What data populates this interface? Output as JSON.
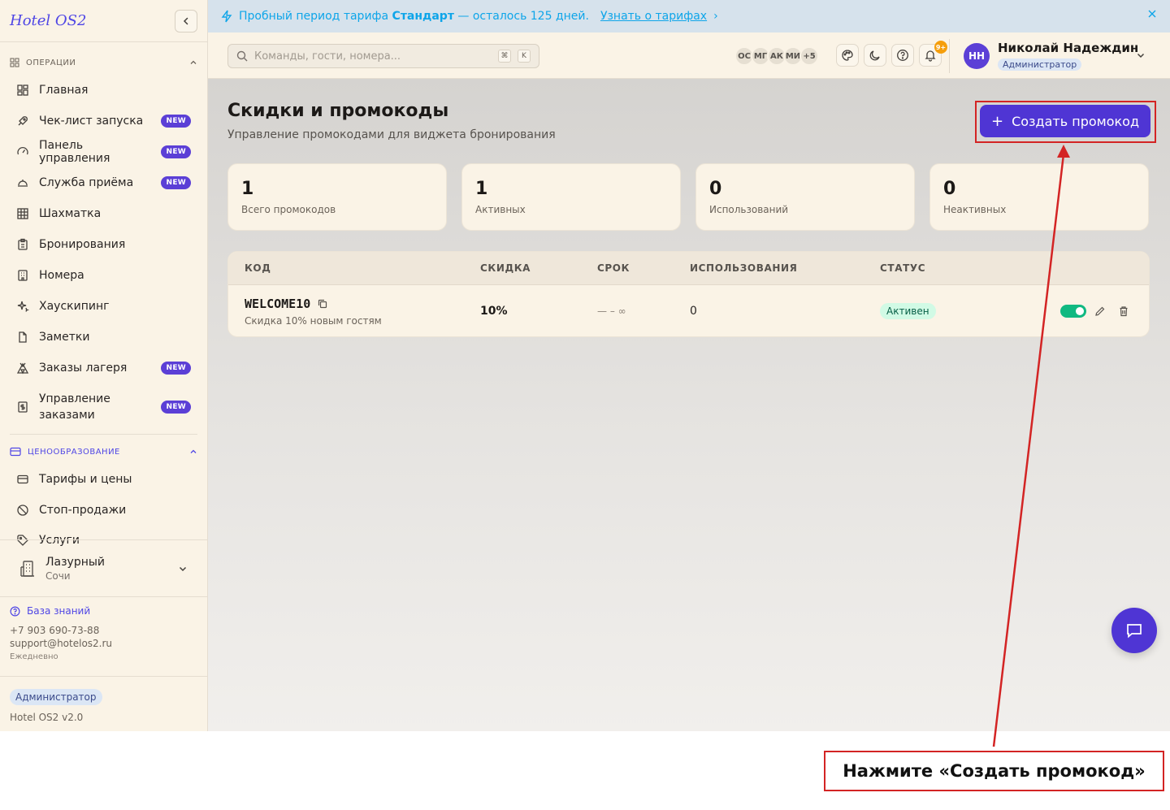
{
  "sidebar": {
    "brand": "Hotel OS2",
    "section_ops": "ОПЕРАЦИИ",
    "ops_items": [
      {
        "label": "Главная",
        "icon": "dashboard-icon"
      },
      {
        "label": "Чек-лист запуска",
        "icon": "rocket-icon",
        "badge": "NEW"
      },
      {
        "label": "Панель управления",
        "icon": "gauge-icon",
        "badge": "NEW"
      },
      {
        "label": "Служба приёма",
        "icon": "bell-service-icon",
        "badge": "NEW"
      },
      {
        "label": "Шахматка",
        "icon": "grid-icon"
      },
      {
        "label": "Бронирования",
        "icon": "clipboard-icon"
      },
      {
        "label": "Номера",
        "icon": "building-icon"
      },
      {
        "label": "Хаускипинг",
        "icon": "sparkles-icon"
      },
      {
        "label": "Заметки",
        "icon": "file-icon"
      },
      {
        "label": "Заказы лагеря",
        "icon": "tent-icon",
        "badge": "NEW"
      },
      {
        "label": "Управление заказами",
        "icon": "dollar-doc-icon",
        "badge": "NEW"
      }
    ],
    "section_pricing": "ЦЕНООБРАЗОВАНИЕ",
    "pricing_items": [
      {
        "label": "Тарифы и цены",
        "icon": "card-icon"
      },
      {
        "label": "Стоп-продажи",
        "icon": "ban-icon"
      },
      {
        "label": "Услуги",
        "icon": "tag-icon"
      }
    ],
    "hotel": {
      "name": "Лазурный",
      "city": "Сочи"
    },
    "support": {
      "kb": "База знаний",
      "phone": "+7 903 690-73-88",
      "email": "support@hotelos2.ru",
      "hours": "Ежедневно"
    },
    "role": "Администратор",
    "version": "Hotel OS2 v2.0"
  },
  "banner": {
    "text_start": "Пробный период тарифа",
    "plan": "Стандарт",
    "text_end": "— осталось 125 дней.",
    "link": "Узнать о тарифах",
    "link_chevron": "›"
  },
  "topbar": {
    "search_placeholder": "Команды, гости, номера...",
    "kbd_cmd": "⌘",
    "kbd_key": "K",
    "avatars": [
      "ОС",
      "МГ",
      "АК",
      "МИ",
      "+5"
    ],
    "notif_count": "9+",
    "user_initials": "НН",
    "user_name": "Николай Надеждин",
    "user_role": "Администратор"
  },
  "page": {
    "title": "Скидки и промокоды",
    "subtitle": "Управление промокодами для виджета бронирования",
    "create_button": "Создать промокод",
    "create_plus": "+"
  },
  "stats": [
    {
      "value": "1",
      "label": "Всего промокодов"
    },
    {
      "value": "1",
      "label": "Активных"
    },
    {
      "value": "0",
      "label": "Использований"
    },
    {
      "value": "0",
      "label": "Неактивных"
    }
  ],
  "table": {
    "columns": [
      "КОД",
      "СКИДКА",
      "СРОК",
      "ИСПОЛЬЗОВАНИЯ",
      "СТАТУС"
    ],
    "rows": [
      {
        "code": "WELCOME10",
        "description": "Скидка 10% новым гостям",
        "discount": "10%",
        "term": "— – ∞",
        "uses": "0",
        "status": "Активен",
        "enabled": true
      }
    ]
  },
  "annotation": {
    "callout": "Нажмите «Создать промокод»",
    "color": "#d32424"
  },
  "colors": {
    "accent": "#4f35d4",
    "brand": "#4f46e5",
    "success": "#10b981",
    "banner_text": "#0ea5e9"
  }
}
